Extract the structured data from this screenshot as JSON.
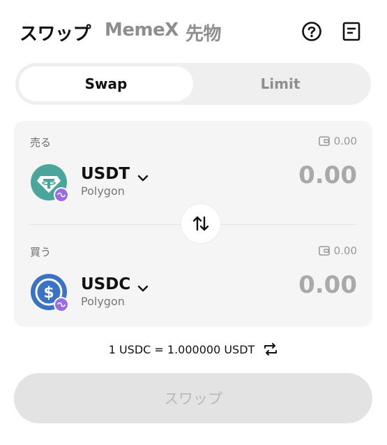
{
  "header": {
    "tabs": [
      {
        "label": "スワップ"
      },
      {
        "label": "MemeX"
      },
      {
        "label": "先物"
      }
    ],
    "icons": [
      "help-icon",
      "orders-icon"
    ]
  },
  "mode": {
    "options": [
      {
        "label": "Swap"
      },
      {
        "label": "Limit"
      }
    ],
    "selected": "Swap"
  },
  "sell": {
    "label": "売る",
    "balance": "0.00",
    "token": {
      "symbol": "USDT",
      "chain": "Polygon",
      "color": "#26a17b"
    },
    "amount": "0.00"
  },
  "buy": {
    "label": "買う",
    "balance": "0.00",
    "token": {
      "symbol": "USDC",
      "chain": "Polygon",
      "color": "#2775ca"
    },
    "amount": "0.00"
  },
  "rate": {
    "text": "1 USDC = 1.000000 USDT"
  },
  "submit": {
    "label": "スワップ"
  },
  "colors": {
    "polygon_badge": "#8247e5",
    "disabled_button": "#e3e3e3"
  }
}
